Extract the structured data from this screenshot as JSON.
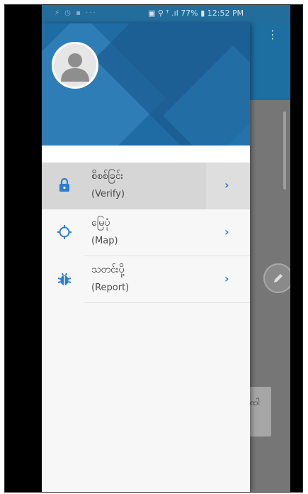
{
  "status_bar": {
    "left_icons": "⚡ ◷ ▪ ···",
    "right_text": "▣ ⚲ ᵀ .ıl 77% ▮ 12:52 PM"
  },
  "app": {
    "more_glyph": "⋮",
    "card_text": "ꩡါ"
  },
  "drawer": {
    "items": [
      {
        "title": "စိစစ်ခြင်း",
        "subtitle": "(Verify)",
        "icon": "lock-icon",
        "chevron": "›",
        "active": true
      },
      {
        "title": "မြေပုံ",
        "subtitle": "(Map)",
        "icon": "crosshair-icon",
        "chevron": "›",
        "active": false
      },
      {
        "title": "သတင်းပို့",
        "subtitle": "(Report)",
        "icon": "bug-icon",
        "chevron": "›",
        "active": false
      }
    ]
  },
  "colors": {
    "accent": "#2b7ed0",
    "header_blue": "#1f6ba4"
  }
}
